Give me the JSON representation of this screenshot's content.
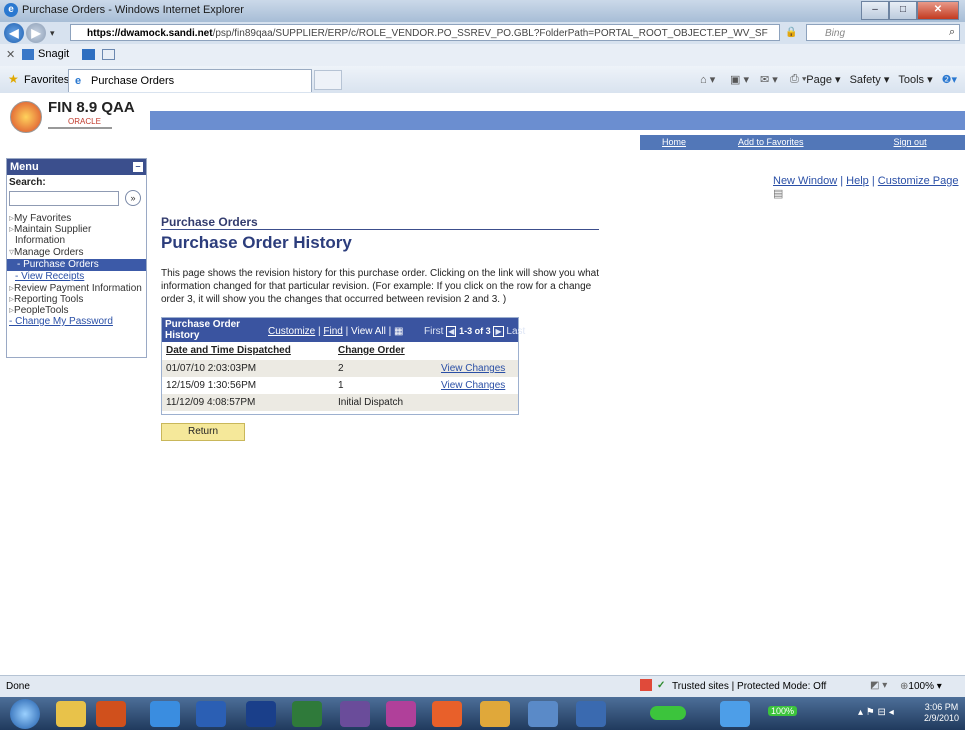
{
  "window": {
    "title": "Purchase Orders - Windows Internet Explorer"
  },
  "address": {
    "url_host": "https://dwamock.sandi.net",
    "url_path": "/psp/fin89qaa/SUPPLIER/ERP/c/ROLE_VENDOR.PO_SSREV_PO.GBL?FolderPath=PORTAL_ROOT_OBJECT.EP_WV_SF",
    "search_placeholder": "Bing"
  },
  "toolbar": {
    "snagit": "Snagit"
  },
  "favorites": {
    "label": "Favorites",
    "tab": "Purchase Orders",
    "cmd": [
      "Page ▾",
      "Safety ▾",
      "Tools ▾"
    ]
  },
  "header": {
    "logo": "FIN 8.9 QAA",
    "logo_sub": "ORACLE",
    "links": [
      "Home",
      "Add to Favorites",
      "Sign out"
    ]
  },
  "menu": {
    "title": "Menu",
    "search_label": "Search:",
    "go": "»",
    "items": [
      "My Favorites",
      "Maintain Supplier",
      "Information",
      "Manage Orders",
      "- Purchase Orders",
      "- View Receipts",
      "Review Payment Information",
      "Reporting Tools",
      "PeopleTools",
      "- Change My Password"
    ]
  },
  "page": {
    "links": [
      "New Window",
      "Help",
      "Customize Page"
    ],
    "section": "Purchase Orders",
    "title": "Purchase Order History",
    "description": "This page shows the revision history for this purchase order. Clicking on the link will show you what information changed for that particular revision. (For example: If you click on the row for a change order 3, it will show you the changes that occurred between revision 2 and 3. )"
  },
  "grid": {
    "title": "Purchase Order History",
    "customize": "Customize",
    "find": "Find",
    "viewall": "View All",
    "first": "First",
    "range": "1-3 of 3",
    "last": "Last",
    "columns": [
      "Date and Time Dispatched",
      "Change Order"
    ],
    "rows": [
      {
        "date": "01/07/10  2:03:03PM",
        "co": "2",
        "link": "View Changes"
      },
      {
        "date": "12/15/09  1:30:56PM",
        "co": "1",
        "link": "View Changes"
      },
      {
        "date": "11/12/09  4:08:57PM",
        "co": "Initial Dispatch",
        "link": ""
      }
    ]
  },
  "buttons": {
    "return": "Return"
  },
  "status": {
    "left": "Done",
    "zone": "Trusted sites | Protected Mode: Off",
    "zoom": "100%"
  },
  "taskbar": {
    "time": "3:06 PM",
    "date": "2/9/2010",
    "battery": "100%"
  }
}
